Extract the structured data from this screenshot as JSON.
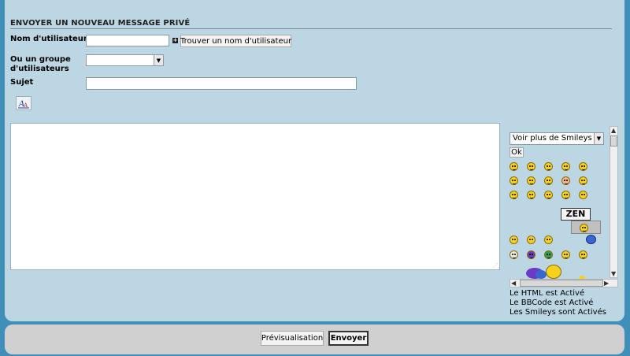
{
  "form": {
    "title": "ENVOYER UN NOUVEAU MESSAGE PRIVÉ",
    "username_label": "Nom d'utilisateur",
    "username_value": "",
    "find_user_button": "Trouver un nom d'utilisateur",
    "group_label": "Ou un groupe d'utilisateurs",
    "group_value": "",
    "subject_label": "Sujet",
    "subject_value": "",
    "message_value": ""
  },
  "smileys": {
    "select_value": "Voir plus de Smileys",
    "ok_button": "Ok",
    "zen_sign": "ZEN",
    "colors": {
      "yellow": "#f7d21d",
      "blue": "#3a66d0",
      "purple": "#6b3bc6",
      "green": "#2f9e5a"
    }
  },
  "status": {
    "html": "Le HTML est Activé",
    "bbcode": "Le BBCode est Activé",
    "smileys": "Les Smileys sont Activés"
  },
  "actions": {
    "preview_button": "Prévisualisation",
    "send_button": "Envoyer"
  },
  "icons": {
    "font_color": "font-color-icon",
    "expand": "plus-icon",
    "dropdown": "chevron-down-icon"
  }
}
